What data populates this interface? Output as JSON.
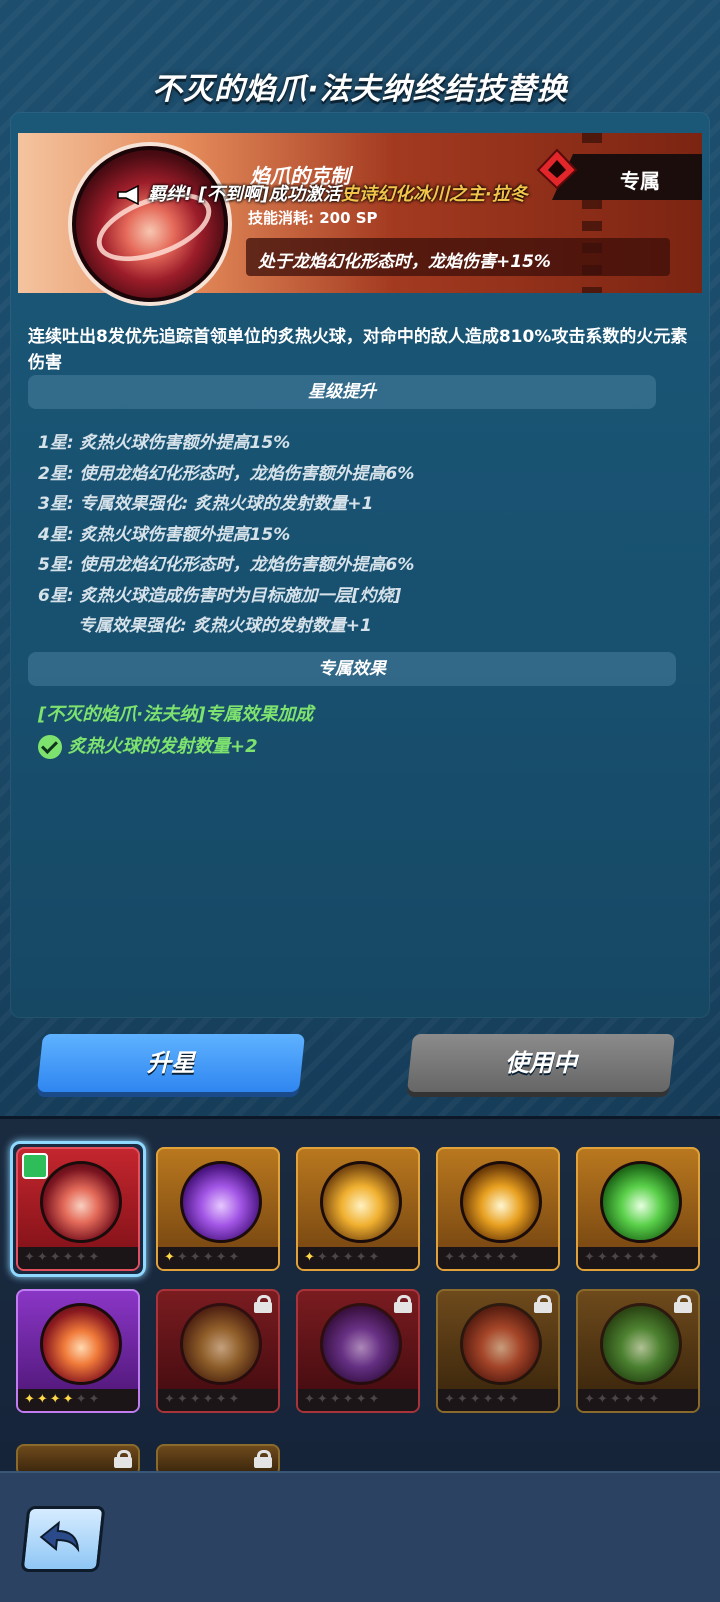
{
  "title": "不灭的焰爪·法夫纳终结技替换",
  "skill": {
    "name": "焰爪的克制",
    "cost": "技能消耗: 200 SP",
    "exclusive_label": "专属",
    "exclusive_effect": "处于龙焰幻化形态时，龙焰伤害+15%"
  },
  "bond_toast": {
    "prefix": "羁绊! [不到啊]成功激活",
    "highlight": "史诗幻化冰川之主·拉冬"
  },
  "description": "连续吐出8发优先追踪首领单位的炙热火球，对命中的敌人造成810%攻击系数的火元素伤害",
  "star_section_title": "星级提升",
  "star_lines": [
    "1星: 炙热火球伤害额外提高15%",
    "2星: 使用龙焰幻化形态时，龙焰伤害额外提高6%",
    "3星: 专属效果强化: 炙热火球的发射数量+1",
    "4星: 炙热火球伤害额外提高15%",
    "5星: 使用龙焰幻化形态时，龙焰伤害额外提高6%",
    "6星: 炙热火球造成伤害时为目标施加一层[灼烧]",
    "专属效果强化: 炙热火球的发射数量+1"
  ],
  "exclusive_section_title": "专属效果",
  "exclusive_bonus_title": "[不灭的焰爪·法夫纳]专属效果加成",
  "exclusive_bonus_item": "炙热火球的发射数量+2",
  "buttons": {
    "upgrade": "升星",
    "in_use": "使用中"
  },
  "cards": [
    {
      "stars": 0,
      "locked": false,
      "selected": true,
      "equipped": true
    },
    {
      "stars": 1,
      "locked": false
    },
    {
      "stars": 1,
      "locked": false
    },
    {
      "stars": 0,
      "locked": false
    },
    {
      "stars": 0,
      "locked": false
    },
    {
      "stars": 4,
      "locked": false
    },
    {
      "stars": 0,
      "locked": true
    },
    {
      "stars": 0,
      "locked": true
    },
    {
      "stars": 0,
      "locked": true
    },
    {
      "stars": 0,
      "locked": true
    }
  ],
  "colors": {
    "accent_green": "#7ee36e",
    "upgrade_blue": "#2f86f0",
    "bond_gold": "#f2c54a"
  }
}
